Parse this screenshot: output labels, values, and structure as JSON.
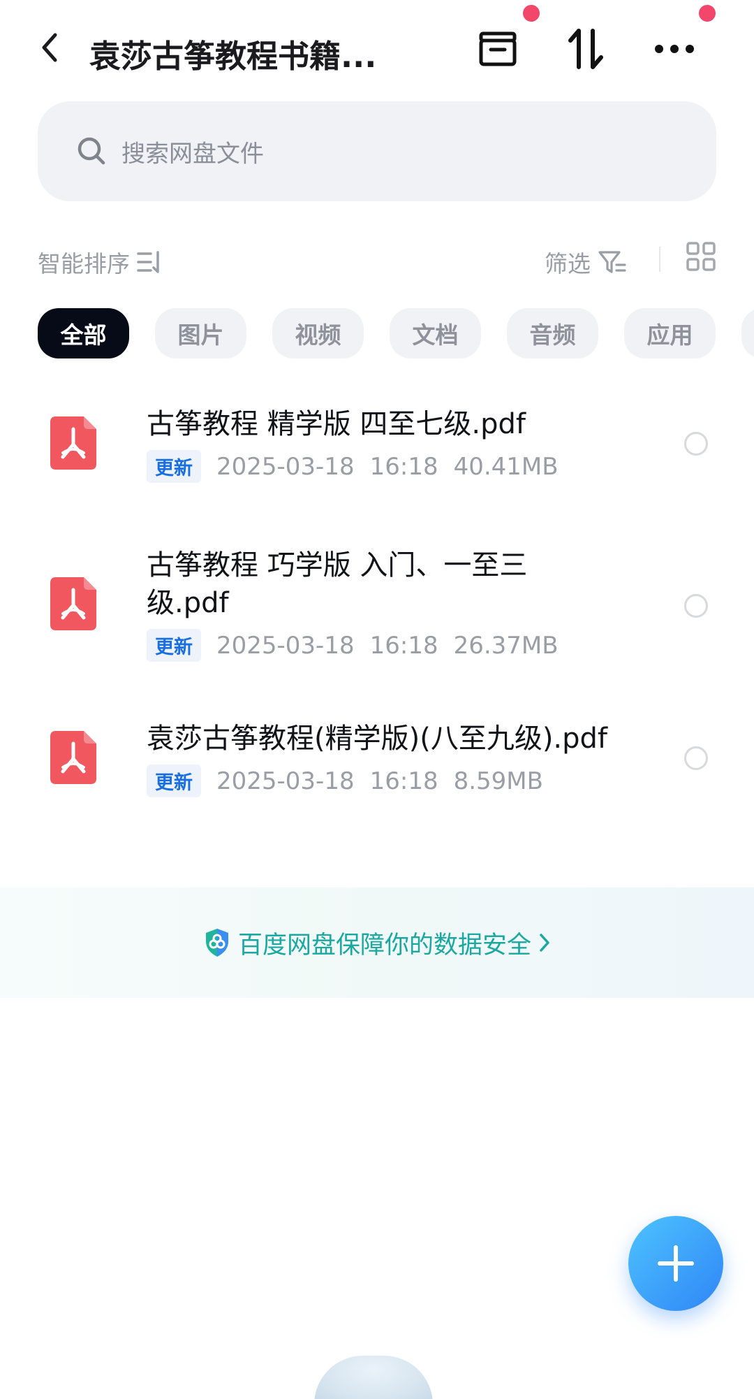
{
  "header": {
    "title": "袁莎古筝教程书籍...",
    "icons": [
      "back-icon",
      "archive-box-icon",
      "sort-transfer-icon",
      "more-icon"
    ]
  },
  "search": {
    "placeholder": "搜索网盘文件"
  },
  "sort_bar": {
    "sort_label": "智能排序",
    "filter_label": "筛选"
  },
  "tabs": [
    {
      "label": "全部",
      "active": true
    },
    {
      "label": "图片",
      "active": false
    },
    {
      "label": "视频",
      "active": false
    },
    {
      "label": "文档",
      "active": false
    },
    {
      "label": "音频",
      "active": false
    },
    {
      "label": "应用",
      "active": false
    }
  ],
  "files": [
    {
      "name": "古筝教程  精学版  四至七级.pdf",
      "badge": "更新",
      "date": "2025-03-18",
      "time": "16:18",
      "size": "40.41MB"
    },
    {
      "name": "古筝教程  巧学版  入门、一至三级.pdf",
      "badge": "更新",
      "date": "2025-03-18",
      "time": "16:18",
      "size": "26.37MB"
    },
    {
      "name": "袁莎古筝教程(精学版)(八至九级).pdf",
      "badge": "更新",
      "date": "2025-03-18",
      "time": "16:18",
      "size": "8.59MB"
    }
  ],
  "safety_banner": {
    "text": "百度网盘保障你的数据安全"
  },
  "colors": {
    "accent": "#2f86f6",
    "badge_text": "#1a6fe0",
    "safety_text": "#1aa8a0",
    "pdf_red": "#f0575f",
    "notification_dot": "#f2466b"
  }
}
